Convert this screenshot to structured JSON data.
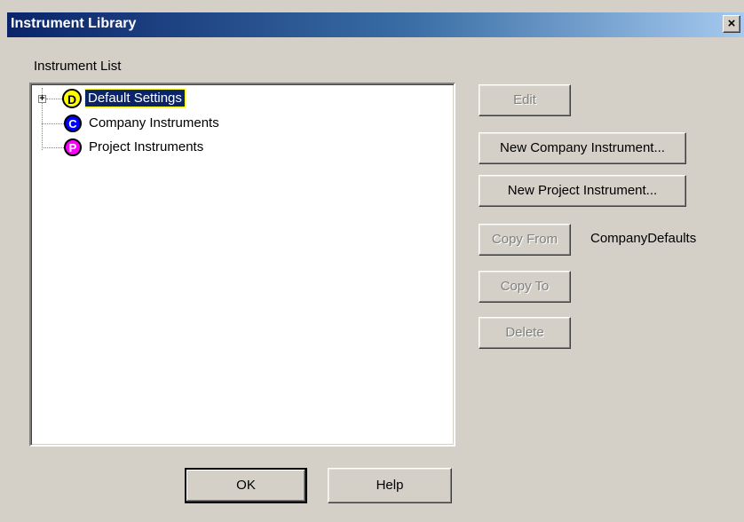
{
  "window": {
    "title": "Instrument Library",
    "close_glyph": "×"
  },
  "tree": {
    "label": "Instrument List",
    "expander_glyph": "+",
    "nodes": [
      {
        "icon": "D",
        "icon_name": "default-settings-icon",
        "label": "Default Settings",
        "selected": true,
        "color": "#ffff00"
      },
      {
        "icon": "C",
        "icon_name": "company-icon",
        "label": "Company Instruments",
        "color": "#0000ff"
      },
      {
        "icon": "P",
        "icon_name": "project-icon",
        "label": "Project Instruments",
        "color": "#ff00ff"
      }
    ]
  },
  "buttons": {
    "edit": "Edit",
    "new_company": "New Company Instrument...",
    "new_project": "New Project Instrument...",
    "copy_from": "Copy From",
    "copy_to": "Copy To",
    "delete": "Delete",
    "ok": "OK",
    "help": "Help"
  },
  "copy_from_value": "CompanyDefaults"
}
